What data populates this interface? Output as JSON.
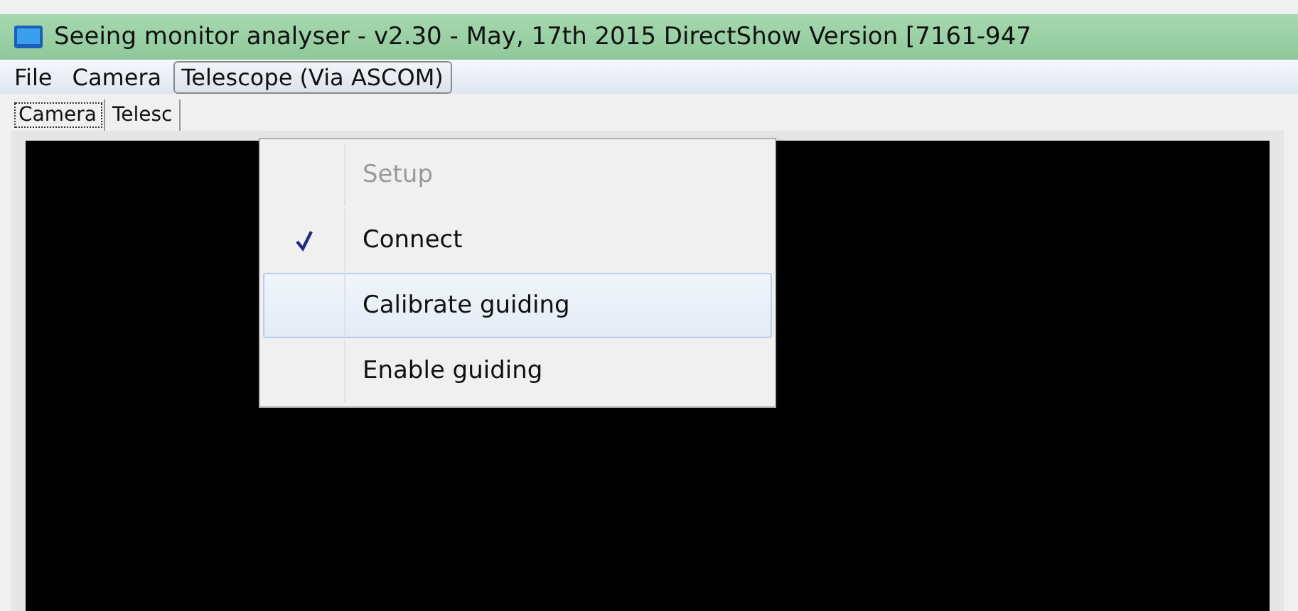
{
  "window": {
    "title": "Seeing monitor analyser - v2.30 - May, 17th 2015 DirectShow Version  [7161-947"
  },
  "menu_bar": [
    {
      "label": "File",
      "selected": false
    },
    {
      "label": "Camera",
      "selected": false
    },
    {
      "label": "Telescope (Via ASCOM)",
      "selected": true
    }
  ],
  "tabs": [
    {
      "label": "Camera",
      "selected": true
    },
    {
      "label": "Telesc",
      "selected": false
    }
  ],
  "dropdown": [
    {
      "label": "Setup",
      "disabled": true,
      "checked": false,
      "selected": false
    },
    {
      "label": "Connect",
      "disabled": false,
      "checked": true,
      "selected": false
    },
    {
      "label": "Calibrate guiding",
      "disabled": false,
      "checked": false,
      "selected": true
    },
    {
      "label": "Enable guiding",
      "disabled": false,
      "checked": false,
      "selected": false
    }
  ]
}
